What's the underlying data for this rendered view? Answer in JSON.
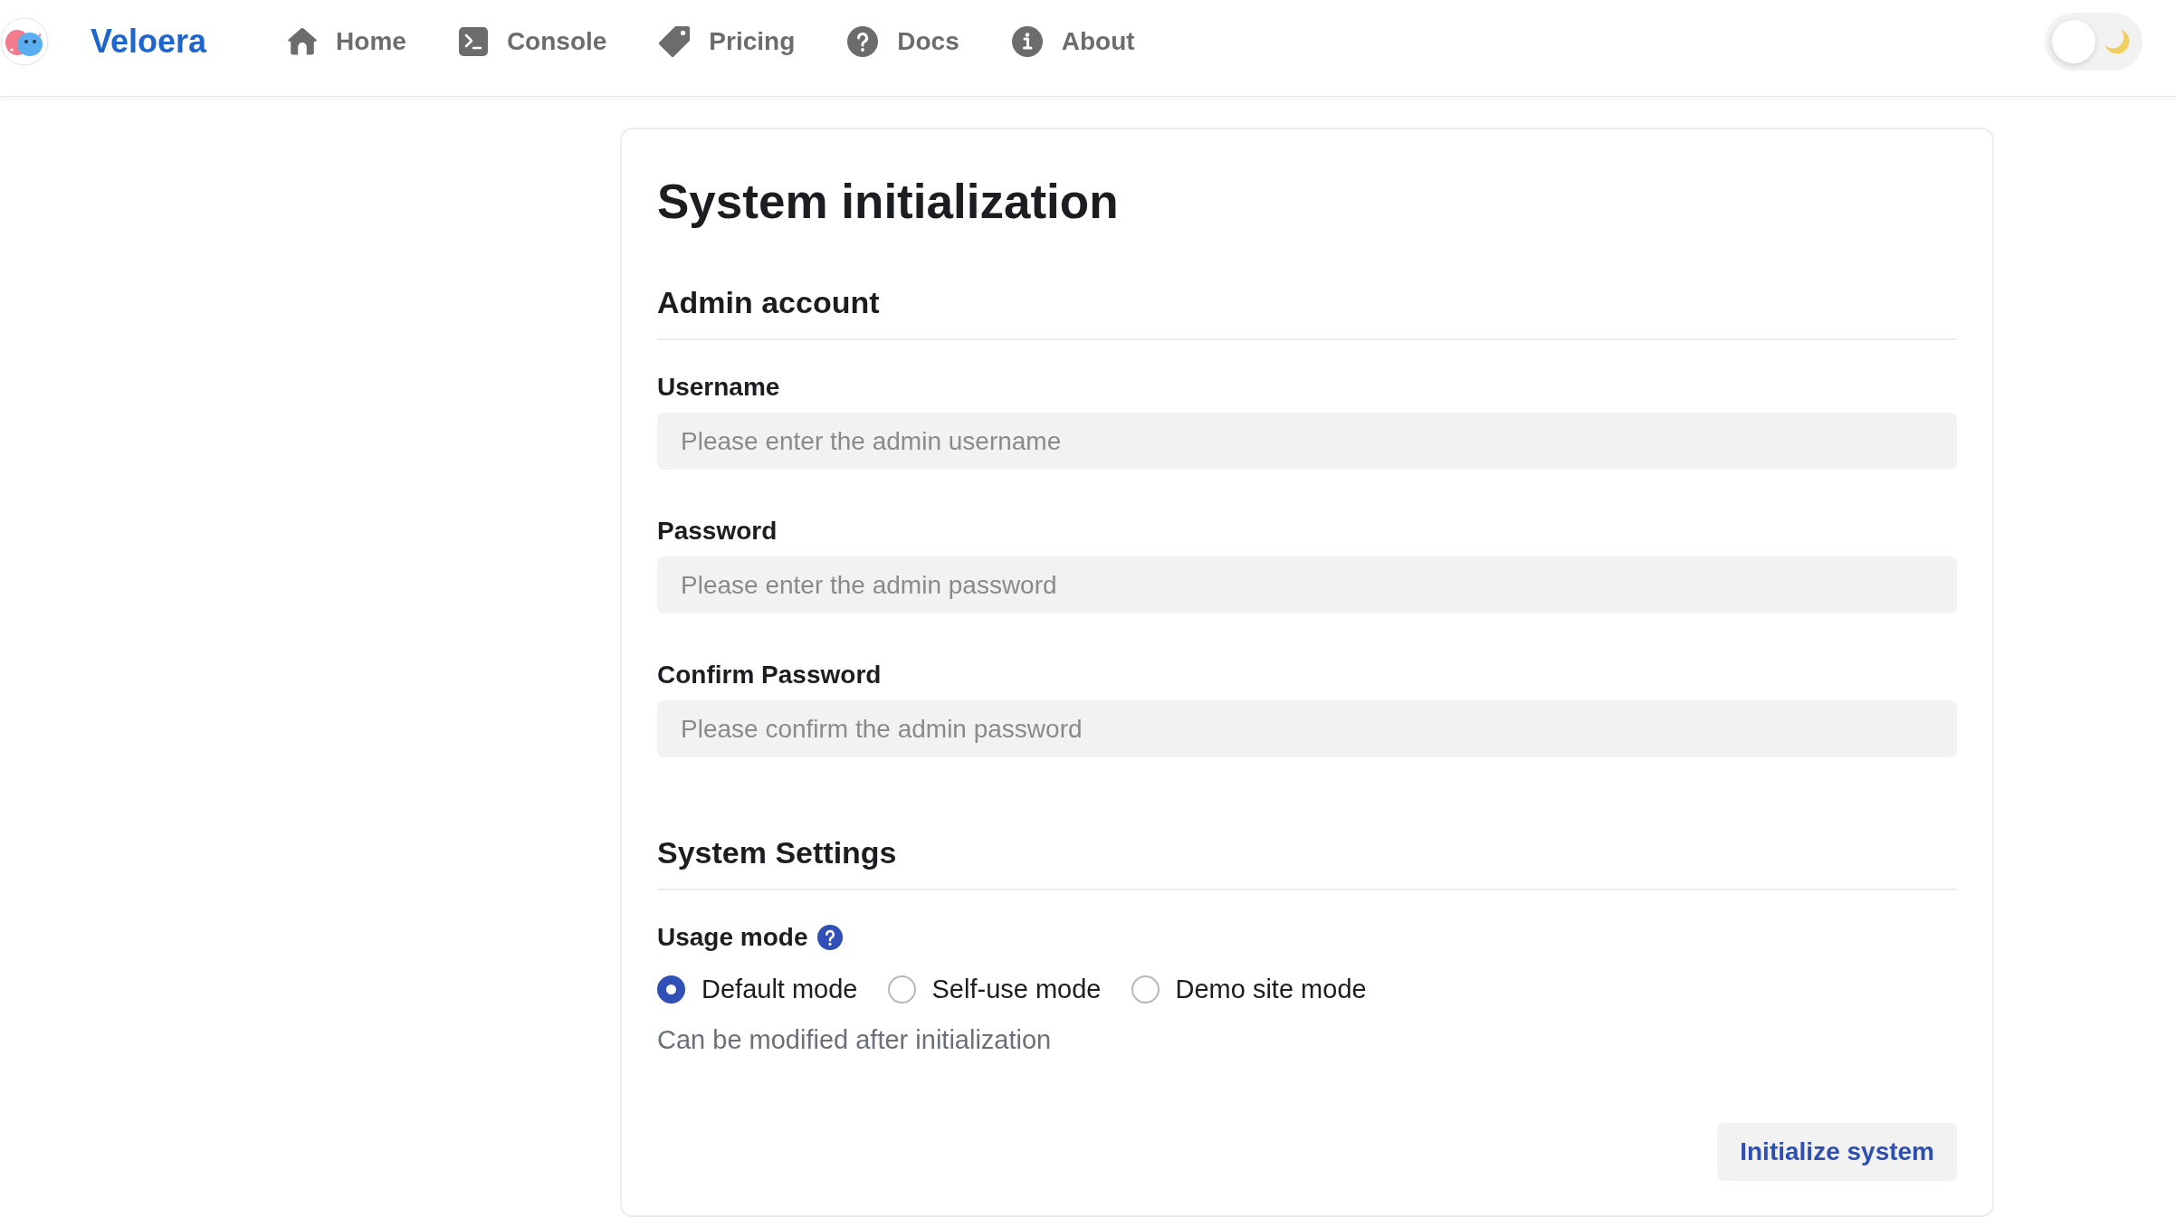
{
  "navbar": {
    "brand": "Veloera",
    "links": [
      {
        "label": "Home"
      },
      {
        "label": "Console"
      },
      {
        "label": "Pricing"
      },
      {
        "label": "Docs"
      },
      {
        "label": "About"
      }
    ],
    "dark_mode": false
  },
  "form": {
    "title": "System initialization",
    "sections": [
      {
        "heading": "Admin account",
        "fields": [
          {
            "kind": "input",
            "label": "Username",
            "placeholder": "Please enter the admin username"
          },
          {
            "kind": "input",
            "label": "Password",
            "placeholder": "Please enter the admin password"
          },
          {
            "kind": "input",
            "label": "Confirm Password",
            "placeholder": "Please confirm the admin password"
          }
        ]
      },
      {
        "heading": "System Settings",
        "fields": [
          {
            "kind": "radio",
            "label": "Usage mode",
            "help": true,
            "options": [
              {
                "label": "Default mode",
                "selected": true
              },
              {
                "label": "Self-use mode",
                "selected": false
              },
              {
                "label": "Demo site mode",
                "selected": false
              }
            ],
            "hint": "Can be modified after initialization"
          }
        ]
      }
    ],
    "submit": "Initialize system"
  }
}
